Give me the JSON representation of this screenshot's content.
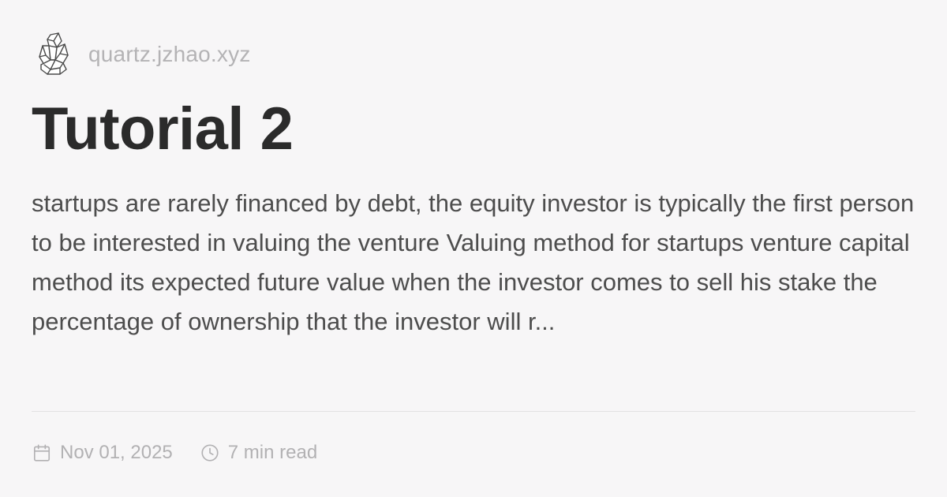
{
  "header": {
    "logo_icon": "crystal-icon",
    "site_name": "quartz.jzhao.xyz"
  },
  "title": "Tutorial 2",
  "description": "startups are rarely financed by debt, the equity investor is typically the first person to be interested in valuing the venture Valuing method for startups venture capital method its expected future value when the investor comes to sell his stake the percentage of ownership that the investor will r...",
  "meta": {
    "date_icon": "calendar-icon",
    "date": "Nov 01, 2025",
    "reading_time_icon": "clock-icon",
    "reading_time": "7 min read"
  },
  "colors": {
    "background": "#f7f6f7",
    "title": "#2b2b2b",
    "body_text": "#4d4d4d",
    "muted_text": "#b2b1b3",
    "divider": "#e3e1e3"
  }
}
